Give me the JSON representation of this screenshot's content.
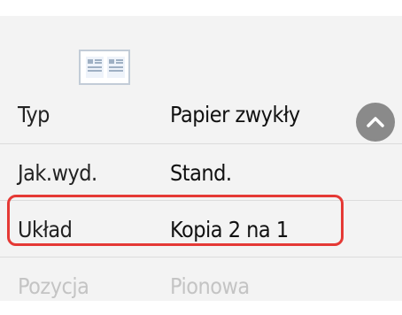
{
  "settings": [
    {
      "label": "Typ",
      "value": "Papier zwykły"
    },
    {
      "label": "Jak.wyd.",
      "value": "Stand."
    },
    {
      "label": "Układ",
      "value": "Kopia 2 na 1"
    },
    {
      "label": "Pozycja",
      "value": "Pionowa"
    }
  ],
  "icons": {
    "layout_preview": "two-on-one-layout-icon",
    "scroll": "chevron-up-icon"
  },
  "colors": {
    "panel_background": "#f3f3f3",
    "highlight_border": "#e53935",
    "scroll_button": "#8a8a8a",
    "disabled_text": "#c4c4c4"
  }
}
